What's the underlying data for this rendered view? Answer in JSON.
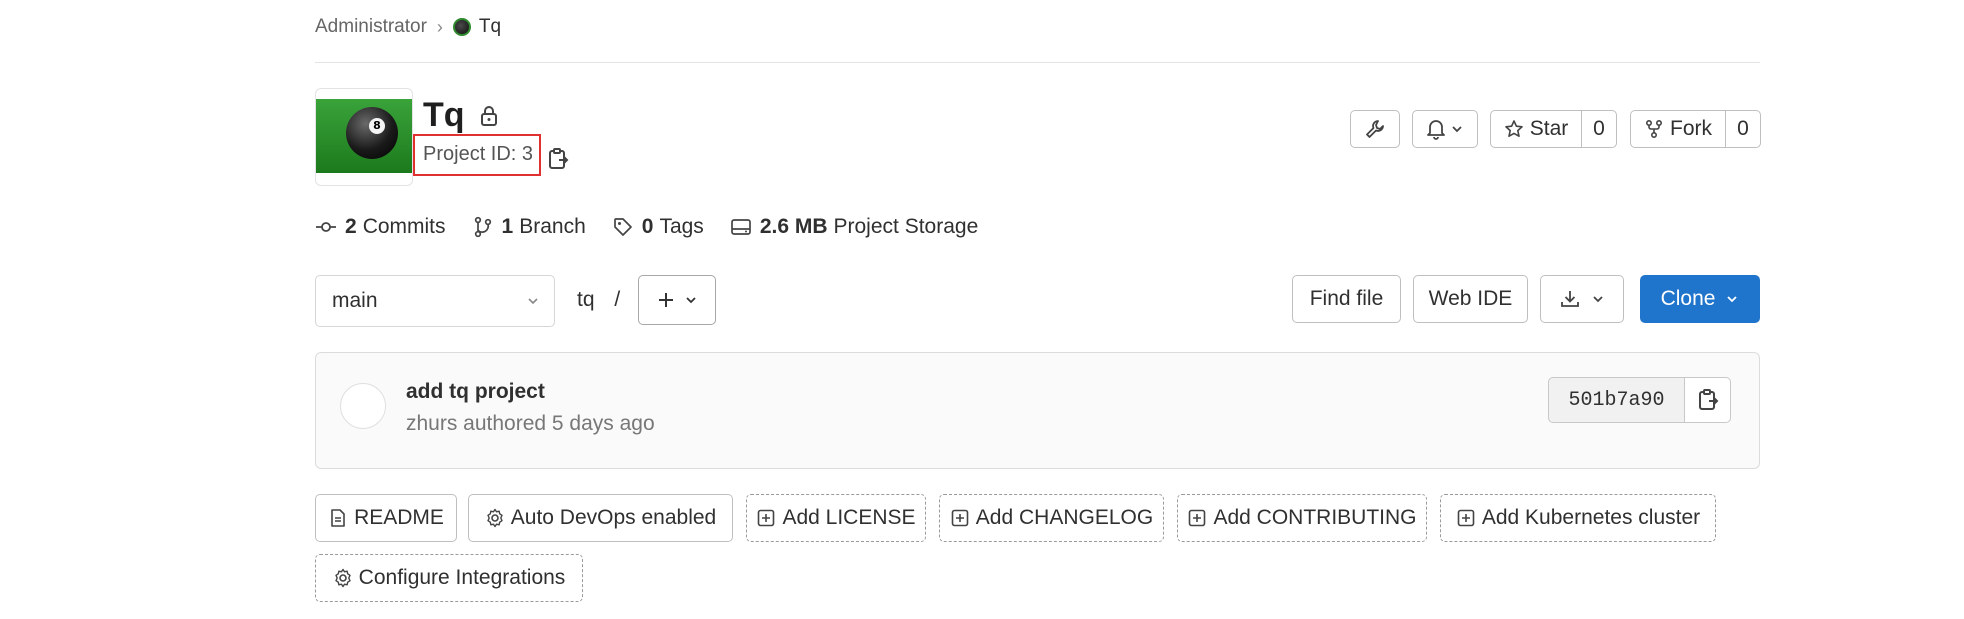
{
  "breadcrumb": {
    "parent": "Administrator",
    "separator": "›",
    "current": "Tq"
  },
  "project": {
    "name": "Tq",
    "id_label": "Project ID: 3"
  },
  "header_actions": {
    "star_label": "Star",
    "star_count": "0",
    "fork_label": "Fork",
    "fork_count": "0"
  },
  "stats": [
    {
      "icon": "commit-icon",
      "count": "2",
      "label": "Commits"
    },
    {
      "icon": "branch-icon",
      "count": "1",
      "label": "Branch"
    },
    {
      "icon": "tag-icon",
      "count": "0",
      "label": "Tags"
    },
    {
      "icon": "storage-icon",
      "count": "2.6 MB",
      "label": "Project Storage"
    }
  ],
  "repo_nav": {
    "branch": "main",
    "path": "tq",
    "path_sep": "/",
    "find_file": "Find file",
    "web_ide": "Web IDE",
    "clone": "Clone"
  },
  "commit": {
    "title": "add tq project",
    "meta": "zhurs authored 5 days ago",
    "sha": "501b7a90"
  },
  "shortcuts": {
    "readme": "README",
    "auto_devops": "Auto DevOps enabled",
    "add_license": "Add LICENSE",
    "add_changelog": "Add CHANGELOG",
    "add_contributing": "Add CONTRIBUTING",
    "add_k8s": "Add Kubernetes cluster",
    "configure_integrations": "Configure Integrations"
  },
  "colors": {
    "primary": "#1f75cb",
    "highlight": "#e03030",
    "border": "#bfbfbf"
  }
}
